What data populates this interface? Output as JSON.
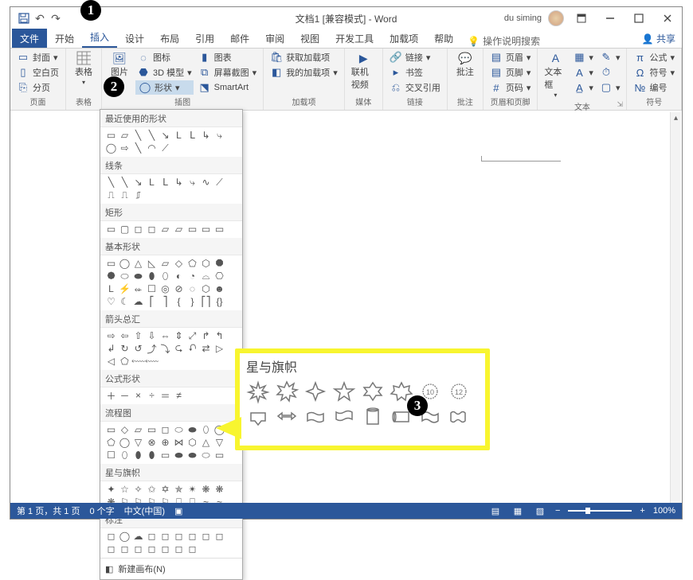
{
  "title": "文档1 [兼容模式] - Word",
  "user": "du siming",
  "tabs": [
    "文件",
    "开始",
    "插入",
    "设计",
    "布局",
    "引用",
    "邮件",
    "审阅",
    "视图",
    "开发工具",
    "加载项",
    "帮助"
  ],
  "tellme": "操作说明搜索",
  "share": "共享",
  "ribbon": {
    "pages": {
      "cover": "封面",
      "blank": "空白页",
      "break": "分页",
      "label": "页面"
    },
    "table": {
      "btn": "表格",
      "label": "表格"
    },
    "illus": {
      "pic": "图片",
      "icons": "图标",
      "chart": "图表",
      "model": "3D 模型",
      "shapes": "形状",
      "screenshot": "屏幕截图",
      "smartart": "SmartArt",
      "label": "插图"
    },
    "addins": {
      "get": "获取加载项",
      "my": "我的加载项",
      "label": "加载项"
    },
    "media": {
      "video": "联机视频",
      "label": "媒体"
    },
    "links": {
      "link": "链接",
      "bookmark": "书签",
      "xref": "交叉引用",
      "label": "链接"
    },
    "comments": {
      "btn": "批注",
      "label": "批注"
    },
    "hf": {
      "header": "页眉",
      "footer": "页脚",
      "pagenum": "页码",
      "label": "页眉和页脚"
    },
    "text": {
      "textbox": "文本框",
      "label": "文本"
    },
    "symbols": {
      "eq": "公式",
      "sym": "符号",
      "num": "编号",
      "label": "符号"
    }
  },
  "dropdown": {
    "recent": "最近使用的形状",
    "lines": "线条",
    "rects": "矩形",
    "basic": "基本形状",
    "arrows": "箭头总汇",
    "equation": "公式形状",
    "flowchart": "流程图",
    "stars": "星与旗帜",
    "callouts": "标注",
    "newcanvas": "新建画布(N)"
  },
  "callout_title": "星与旗帜",
  "status": {
    "page": "第 1 页，共 1 页",
    "words": "0 个字",
    "lang": "中文(中国)",
    "zoom": "100%"
  }
}
